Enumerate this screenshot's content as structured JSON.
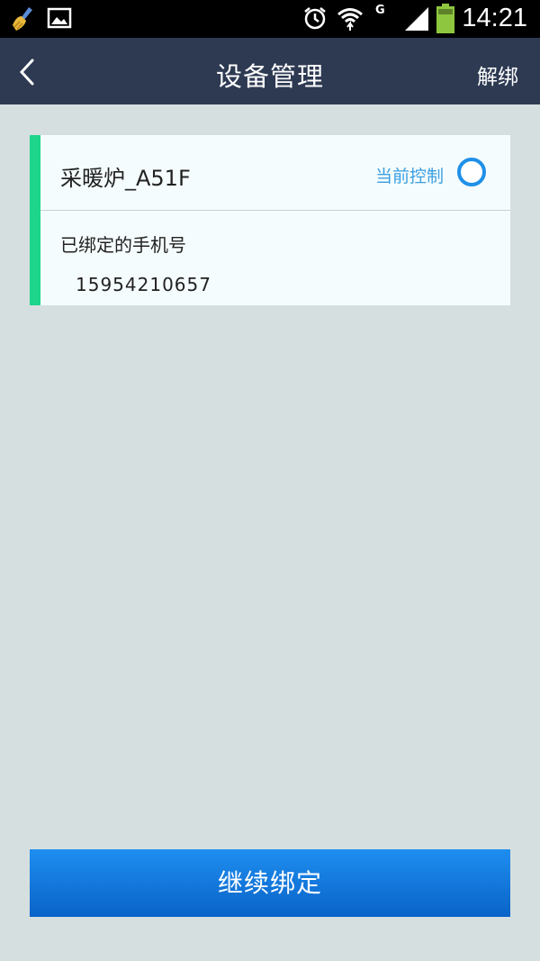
{
  "status_bar": {
    "time": "14:21",
    "network": "G",
    "icons": [
      "broom-icon",
      "image-icon",
      "alarm-icon",
      "wifi-icon",
      "signal-icon",
      "battery-icon"
    ],
    "battery_color": "#8ec63f"
  },
  "header": {
    "title": "设备管理",
    "right_action": "解绑",
    "back_icon": "chevron-left-icon",
    "background": "#2e3a52"
  },
  "device": {
    "name": "采暖炉_A51F",
    "status_label": "当前控制",
    "accent_color": "#1ed58c",
    "bound_phone_heading": "已绑定的手机号",
    "bound_phone": "15954210657"
  },
  "footer": {
    "continue_label": "继续绑定",
    "button_color": "#1e8ef0"
  }
}
